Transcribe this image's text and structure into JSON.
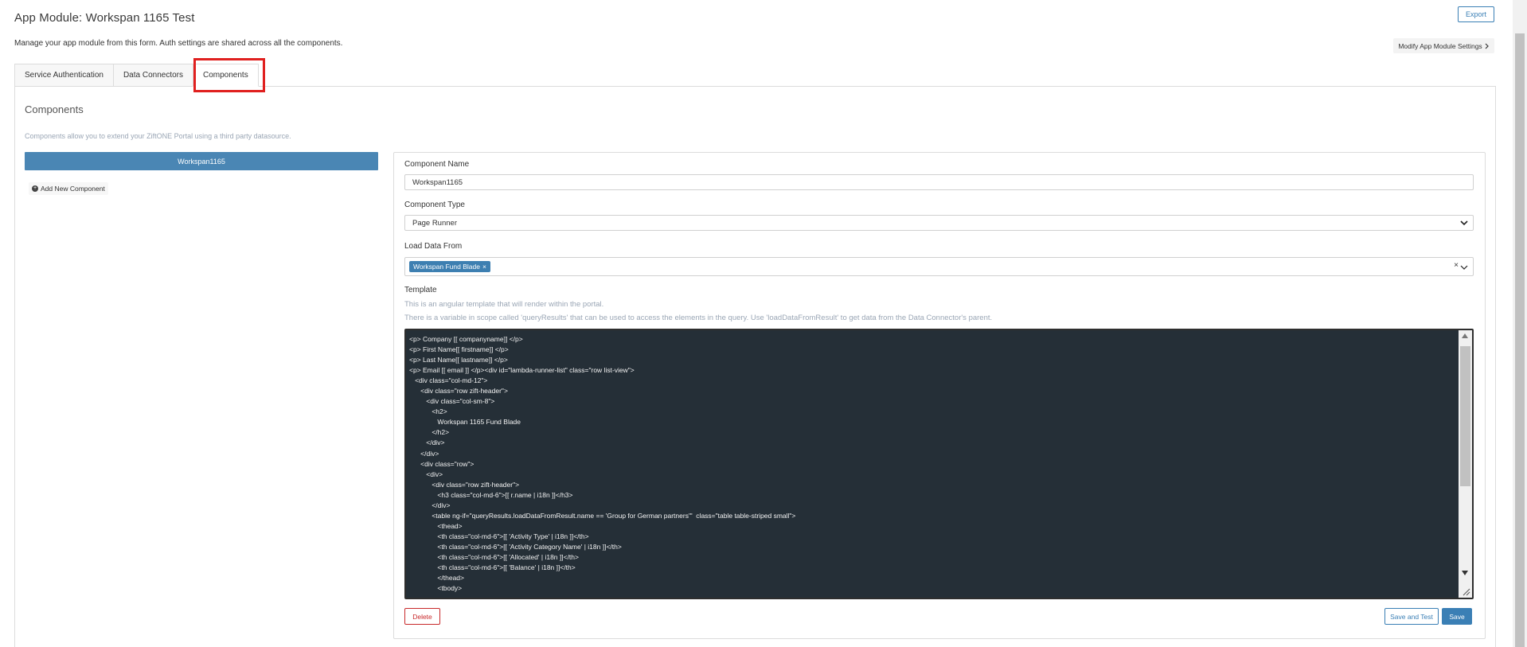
{
  "header": {
    "title": "App Module: Workspan 1165 Test",
    "description": "Manage your app module from this form. Auth settings are shared across all the components.",
    "export_label": "Export",
    "modify_label": "Modify App Module Settings"
  },
  "tabs": [
    {
      "label": "Service Authentication"
    },
    {
      "label": "Data Connectors"
    },
    {
      "label": "Components"
    }
  ],
  "components_section": {
    "title": "Components",
    "description": "Components allow you to extend your ZiftONE Portal using a third party datasource.",
    "items": [
      {
        "label": "Workspan1165"
      }
    ],
    "add_label": "Add New Component"
  },
  "form": {
    "name_label": "Component Name",
    "name_value": "Workspan1165",
    "type_label": "Component Type",
    "type_value": "Page Runner",
    "load_label": "Load Data From",
    "load_tag": "Workspan Fund Blade",
    "template_label": "Template",
    "template_hint1": "This is an angular template that will render within the portal.",
    "template_hint2": "There is a variable in scope called 'queryResults' that can be used to access the elements in the query. Use 'loadDataFromResult' to get data from the Data Connector's parent.",
    "template_code": "<p> Company [[ companyname]] </p>\n<p> First Name[[ firstname]] </p>\n<p> Last Name[[ lastname]] </p>\n<p> Email [[ email ]] </p><div id=\"lambda-runner-list\" class=\"row list-view\">\n   <div class=\"col-md-12\">\n      <div class=\"row zift-header\">\n         <div class=\"col-sm-8\">\n            <h2>\n               Workspan 1165 Fund Blade\n            </h2>\n         </div>\n      </div>\n      <div class=\"row\">\n         <div>\n            <div class=\"row zift-header\">\n               <h3 class=\"col-md-6\">[[ r.name | i18n ]]</h3>\n            </div>\n            <table ng-if=\"queryResults.loadDataFromResult.name == 'Group for German partners'\"  class=\"table table-striped small\">\n               <thead>\n               <th class=\"col-md-6\">[[ 'Activity Type' | i18n ]]</th>\n               <th class=\"col-md-6\">[[ 'Activity Category Name' | i18n ]]</th>\n               <th class=\"col-md-6\">[[ 'Allocated' | i18n ]]</th>\n               <th class=\"col-md-6\">[[ 'Balance' | i18n ]]</th>\n               </thead>\n               <tbody>",
    "delete_label": "Delete",
    "save_test_label": "Save and Test",
    "save_label": "Save"
  }
}
